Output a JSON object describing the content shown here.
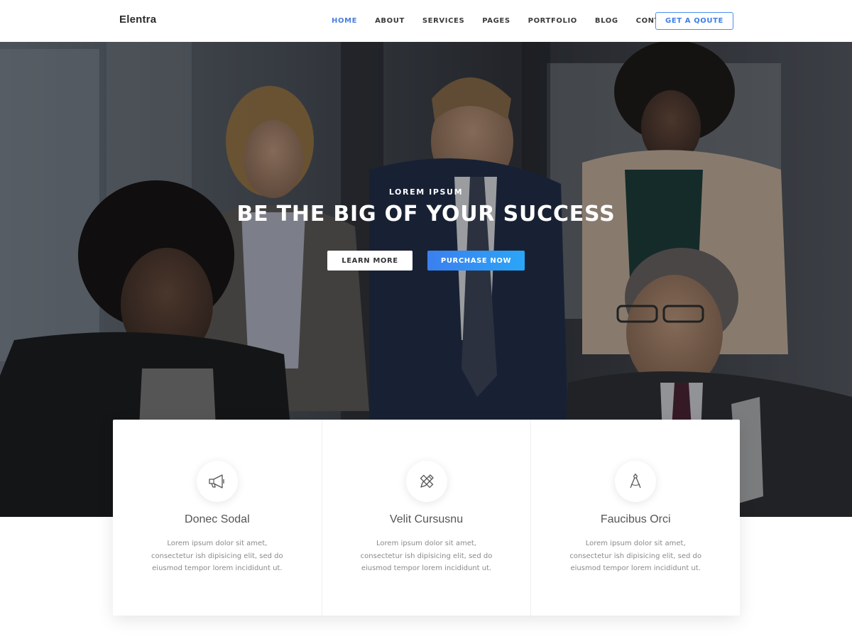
{
  "header": {
    "logo": "Elentra",
    "nav": [
      {
        "label": "HOME",
        "active": true
      },
      {
        "label": "ABOUT",
        "active": false
      },
      {
        "label": "SERVICES",
        "active": false
      },
      {
        "label": "PAGES",
        "active": false
      },
      {
        "label": "PORTFOLIO",
        "active": false
      },
      {
        "label": "BLOG",
        "active": false
      },
      {
        "label": "CONTACT",
        "active": false
      }
    ],
    "quote_button": "GET A QOUTE"
  },
  "hero": {
    "subtitle": "LOREM IPSUM",
    "title": "BE THE BIG OF YOUR SUCCESS",
    "learn_more": "LEARN MORE",
    "purchase_now": "PURCHASE NOW"
  },
  "features": [
    {
      "icon": "megaphone-icon",
      "title": "Donec Sodal",
      "text": "Lorem ipsum dolor sit amet, consectetur ish dipisicing elit, sed do eiusmod tempor lorem incididunt ut."
    },
    {
      "icon": "pencil-ruler-icon",
      "title": "Velit Cursusnu",
      "text": "Lorem ipsum dolor sit amet, consectetur ish dipisicing elit, sed do eiusmod tempor lorem incididunt ut."
    },
    {
      "icon": "compass-icon",
      "title": "Faucibus Orci",
      "text": "Lorem ipsum dolor sit amet, consectetur ish dipisicing elit, sed do eiusmod tempor lorem incididunt ut."
    }
  ],
  "colors": {
    "accent": "#4a7fd8",
    "button_gradient_start": "#3b7ff0",
    "button_gradient_end": "#2aa6f7"
  }
}
